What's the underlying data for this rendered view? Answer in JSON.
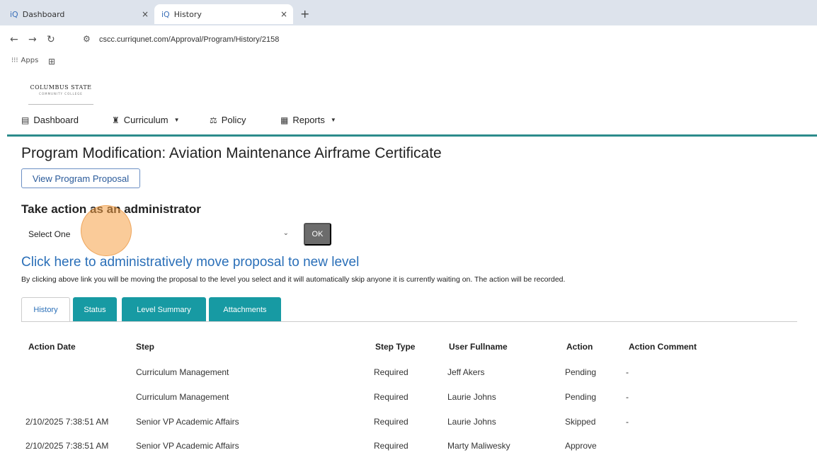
{
  "browser": {
    "tabs": [
      {
        "title": "Dashboard",
        "close": "×"
      },
      {
        "title": "History",
        "close": "×"
      }
    ],
    "new_tab": "+",
    "url": "cscc.curriqunet.com/Approval/Program/History/2158",
    "bookmarks": {
      "apps_label": "Apps"
    }
  },
  "site": {
    "logo_text": "COLUMBUS STATE",
    "logo_sub": "COMMUNITY COLLEGE",
    "nav": [
      {
        "label": "Dashboard"
      },
      {
        "label": "Curriculum"
      },
      {
        "label": "Policy"
      },
      {
        "label": "Reports"
      }
    ]
  },
  "page": {
    "title": "Program Modification: Aviation Maintenance Airframe Certificate",
    "view_button": "View Program Proposal",
    "admin_heading": "Take action as an administrator",
    "select_value": "Select One",
    "ok_label": "OK",
    "move_link": "Click here to administratively move proposal to new level",
    "move_note": "By clicking above link you will be moving the proposal to the level you select and it will automatically skip anyone it is currently waiting on. The action will be recorded.",
    "tabs": [
      "History",
      "Status",
      "Level Summary",
      "Attachments"
    ]
  },
  "table": {
    "headers": [
      "Action Date",
      "Step",
      "Step Type",
      "User Fullname",
      "Action",
      "Action Comment"
    ],
    "rows": [
      [
        "",
        "Curriculum Management",
        "Required",
        "Jeff Akers",
        "Pending",
        "-"
      ],
      [
        "",
        "Curriculum Management",
        "Required",
        "Laurie Johns",
        "Pending",
        "-"
      ],
      [
        "2/10/2025 7:38:51 AM",
        "Senior VP Academic Affairs",
        "Required",
        "Laurie Johns",
        "Skipped",
        "-"
      ],
      [
        "2/10/2025 7:38:51 AM",
        "Senior VP Academic Affairs",
        "Required",
        "Marty Maliwesky",
        "Approve",
        ""
      ]
    ]
  },
  "colors": {
    "accent_teal": "#179aa3",
    "link_blue": "#2a6fb8",
    "nav_line": "#2c8c8c"
  }
}
